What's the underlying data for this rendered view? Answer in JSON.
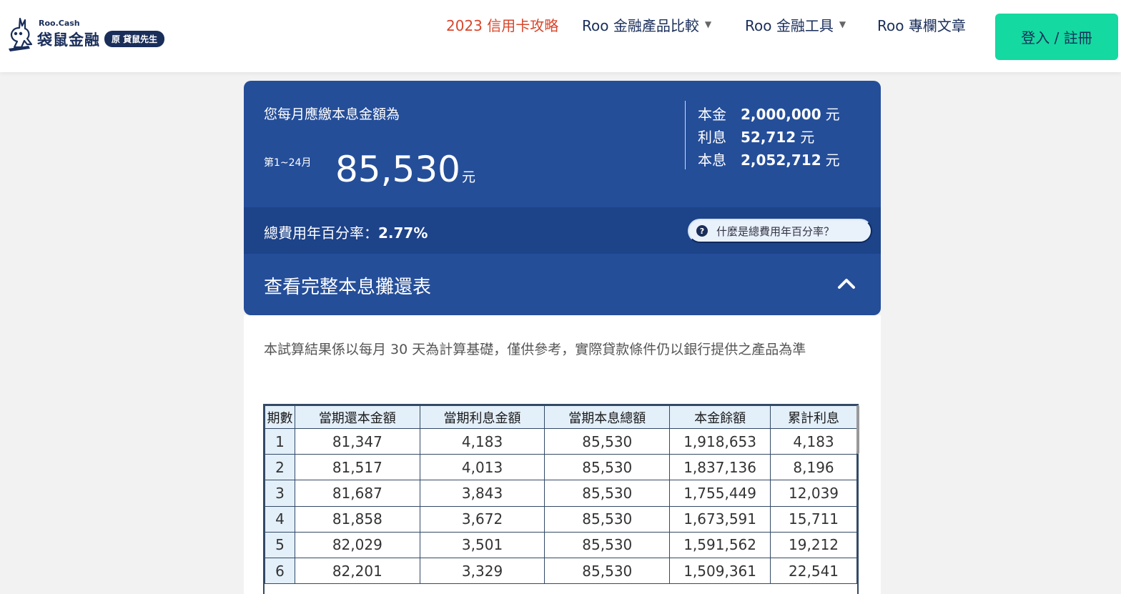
{
  "brand": {
    "name_en": "Roo.Cash",
    "name_zh": "袋鼠金融",
    "tagline": "原 貸鼠先生"
  },
  "nav": {
    "items": [
      {
        "label": "2023 信用卡攻略",
        "dropdown": false,
        "highlight": true
      },
      {
        "label": "Roo 金融產品比較",
        "dropdown": true,
        "highlight": false
      },
      {
        "label": "Roo 金融工具",
        "dropdown": true,
        "highlight": false
      },
      {
        "label": "Roo 專欄文章",
        "dropdown": false,
        "highlight": false
      }
    ],
    "caret": "▼",
    "login_label": "登入 / 註冊"
  },
  "result": {
    "monthly_label": "您每月應繳本息金額為",
    "period_label": "第1~24月",
    "monthly_amount": "85,530",
    "unit": "元",
    "summary": [
      {
        "label": "本金",
        "value": "2,000,000",
        "unit": "元"
      },
      {
        "label": "利息",
        "value": "52,712",
        "unit": "元"
      },
      {
        "label": "本息",
        "value": "2,052,712",
        "unit": "元"
      }
    ],
    "apr_label": "總費用年百分率：",
    "apr_value": "2.77%",
    "apr_help": "什麼是總費用年百分率？",
    "help_icon_glyph": "?",
    "toggle_label": "查看完整本息攤還表"
  },
  "schedule": {
    "note": "本試算結果係以每月 30 天為計算基礎，僅供參考，實際貸款條件仍以銀行提供之產品為準",
    "headers": [
      "期數",
      "當期還本金額",
      "當期利息金額",
      "當期本息總額",
      "本金餘額",
      "累計利息"
    ],
    "rows": [
      [
        "1",
        "81,347",
        "4,183",
        "85,530",
        "1,918,653",
        "4,183"
      ],
      [
        "2",
        "81,517",
        "4,013",
        "85,530",
        "1,837,136",
        "8,196"
      ],
      [
        "3",
        "81,687",
        "3,843",
        "85,530",
        "1,755,449",
        "12,039"
      ],
      [
        "4",
        "81,858",
        "3,672",
        "85,530",
        "1,673,591",
        "15,711"
      ],
      [
        "5",
        "82,029",
        "3,501",
        "85,530",
        "1,591,562",
        "19,212"
      ],
      [
        "6",
        "82,201",
        "3,329",
        "85,530",
        "1,509,361",
        "22,541"
      ]
    ]
  },
  "colors": {
    "brand_navy": "#1a2e5a",
    "card_blue": "#254e99",
    "accent_green": "#14d9a1",
    "highlight_red": "#d9462b"
  }
}
